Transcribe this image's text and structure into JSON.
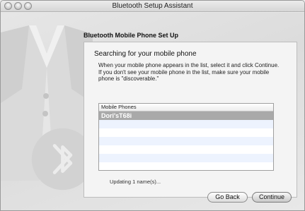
{
  "window": {
    "title": "Bluetooth Setup Assistant"
  },
  "header": {
    "title": "Bluetooth Mobile Phone Set Up"
  },
  "panel": {
    "title": "Searching for your mobile phone",
    "description": "When your mobile phone appears in the list, select it and click Continue. If you don't see your mobile phone in the list, make sure your mobile phone is \"discoverable.\"",
    "list": {
      "header": "Mobile Phones",
      "items": [
        "Dori'sT68i",
        "",
        "",
        "",
        "",
        "",
        ""
      ],
      "selected_index": 0
    },
    "status": "Updating 1 name(s)..."
  },
  "buttons": {
    "back": "Go Back",
    "continue": "Continue"
  },
  "colors": {
    "selection": "#a9a9a9",
    "alt_row": "#edf3fe"
  }
}
